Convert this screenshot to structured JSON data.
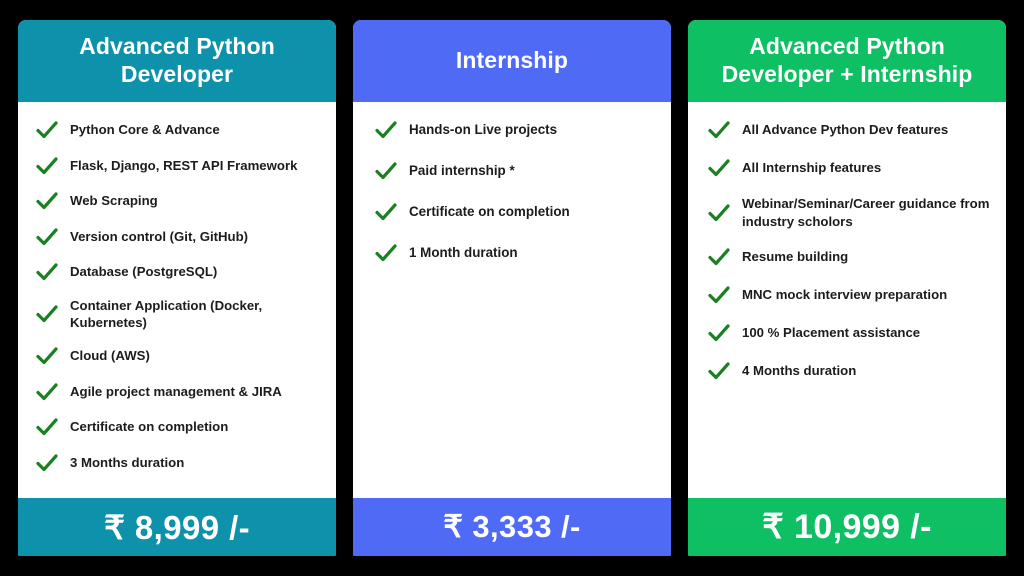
{
  "background_color": "#000000",
  "checkmark_icon": "check-icon",
  "checkmark_color": "#1a8021",
  "cards": [
    {
      "id": "advanced-python-developer",
      "title": "Advanced Python\nDeveloper",
      "title_line_1": "Advanced Python",
      "title_line_2": "Developer",
      "accent_color": "#0e91ab",
      "price": "₹ 8,999 /-",
      "features": [
        "Python Core & Advance",
        "Flask, Django, REST API Framework",
        "Web Scraping",
        "Version control (Git, GitHub)",
        "Database (PostgreSQL)",
        "Container Application (Docker, Kubernetes)",
        "Cloud (AWS)",
        "Agile project management & JIRA",
        "Certificate on completion",
        "3 Months duration"
      ]
    },
    {
      "id": "internship",
      "title": "Internship",
      "title_line_1": "Internship",
      "title_line_2": "",
      "accent_color": "#4f6bf6",
      "price": "₹ 3,333 /-",
      "features": [
        "Hands-on Live projects",
        "Paid internship *",
        "Certificate on completion",
        " 1 Month duration"
      ]
    },
    {
      "id": "advanced-python-developer-plus-internship",
      "title": "Advanced Python\nDeveloper + Internship",
      "title_line_1": "Advanced Python",
      "title_line_2": "Developer + Internship",
      "accent_color": "#0fbf64",
      "price": "₹ 10,999 /-",
      "features": [
        "All Advance Python Dev features",
        "All Internship features",
        "Webinar/Seminar/Career guidance from industry scholors",
        "Resume building",
        "MNC mock interview preparation",
        "100 % Placement  assistance",
        "4 Months duration"
      ]
    }
  ]
}
